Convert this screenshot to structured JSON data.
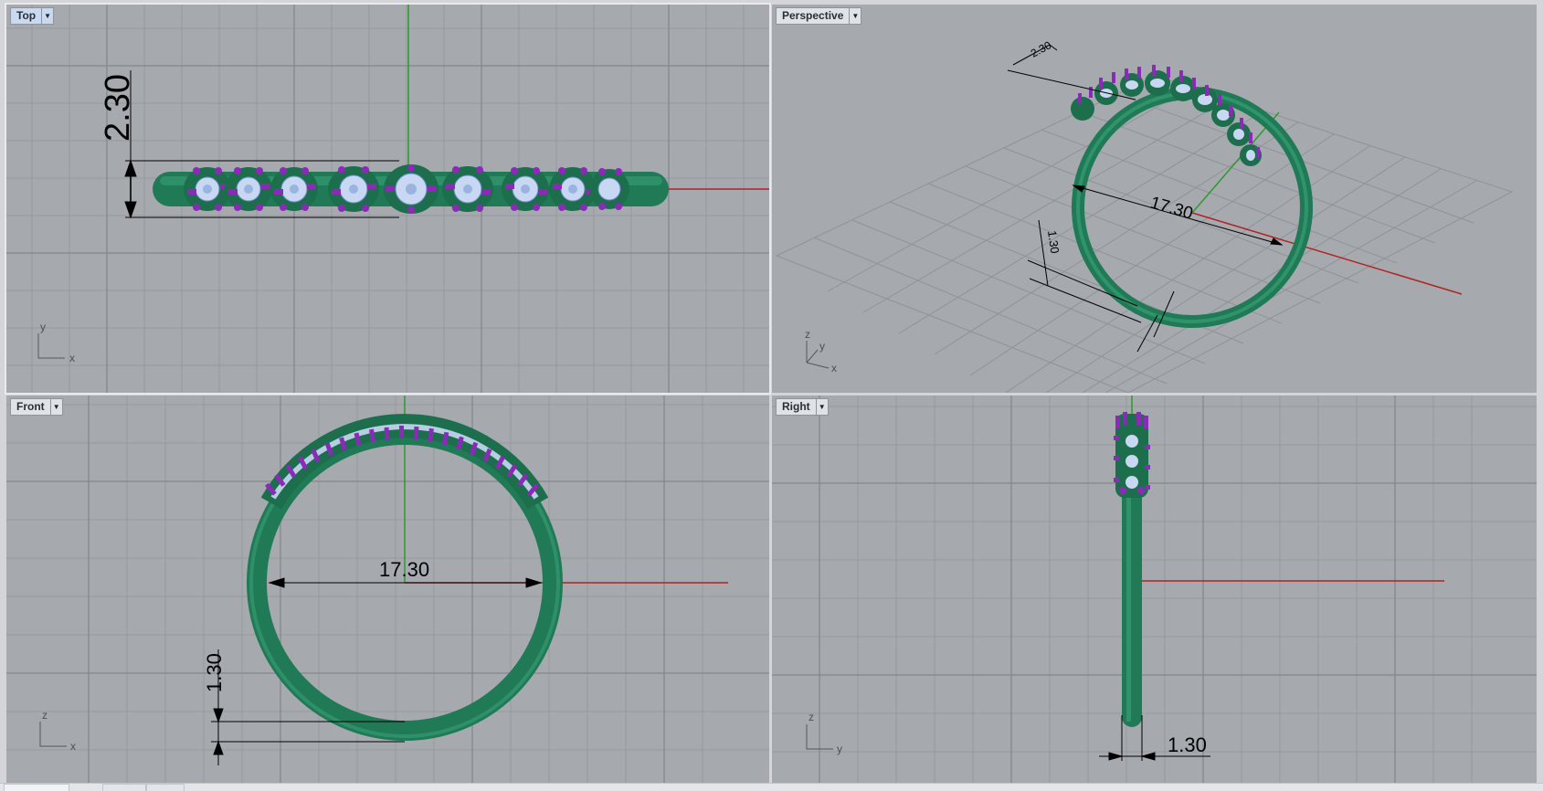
{
  "viewports": {
    "top": {
      "name": "Top",
      "dim_width": "2.30",
      "axis_h": "x",
      "axis_v": "y"
    },
    "perspective": {
      "name": "Perspective",
      "dim_top": "2.30",
      "dim_diameter": "17.30",
      "dim_side": "1.30",
      "axis_z": "z",
      "axis_y": "y",
      "axis_x": "x"
    },
    "front": {
      "name": "Front",
      "dim_diameter": "17.30",
      "dim_thickness": "1.30",
      "axis_h": "x",
      "axis_v": "z"
    },
    "right": {
      "name": "Right",
      "dim_thickness": "1.30",
      "axis_h": "y",
      "axis_v": "z"
    }
  },
  "colors": {
    "viewport_bg": "#a6aaaf",
    "grid_minor": "#9a9ea3",
    "grid_major": "#8b8f95",
    "band": "#1f7a55",
    "band_light": "#3aa37a",
    "prong": "#8a2bb8",
    "stone": "#c8d8f2",
    "x_axis": "#b22222",
    "y_axis": "#2c9a2c"
  },
  "icons": [
    "dropdown-arrow-icon",
    "axis-triad-icon"
  ]
}
